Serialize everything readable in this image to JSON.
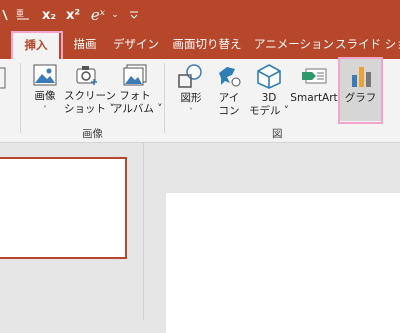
{
  "titlebar": {
    "quick_tools": [
      "ruby-icon",
      "subscript-icon",
      "superscript-icon",
      "equation-icon",
      "dropdown-icon",
      "customize-icon"
    ],
    "subscript": "x₂",
    "superscript": "x²",
    "equation": "eˣ"
  },
  "tabs": [
    {
      "label": "挿入",
      "active": true
    },
    {
      "label": "描画"
    },
    {
      "label": "デザイン"
    },
    {
      "label": "画面切り替え"
    },
    {
      "label": "アニメーション"
    },
    {
      "label": "スライド ショー"
    }
  ],
  "ribbon": {
    "images_group": {
      "label": "画像",
      "buttons": [
        {
          "line1": "画像",
          "line2": "˅"
        },
        {
          "line1": "スクリーン",
          "line2": "ショット ˅"
        },
        {
          "line1": "フォト",
          "line2": "アルバム ˅"
        }
      ]
    },
    "illustrations_group": {
      "label": "図",
      "buttons": [
        {
          "line1": "図形",
          "line2": "˅"
        },
        {
          "line1": "アイ",
          "line2": "コン"
        },
        {
          "line1": "3D",
          "line2": "モデル ˅"
        },
        {
          "line1": "SmartArt",
          "line2": ""
        },
        {
          "line1": "グラフ",
          "line2": ""
        }
      ]
    }
  },
  "colors": {
    "accent": "#b7472a",
    "highlight": "#f2a5c8",
    "ribbon_bg": "#f3f3f3",
    "workspace_bg": "#e6e6e6"
  }
}
